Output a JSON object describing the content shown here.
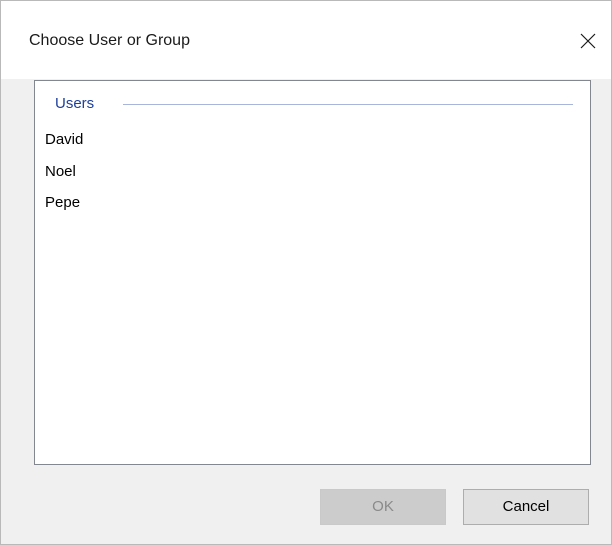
{
  "dialog": {
    "title": "Choose User or Group",
    "close_icon": "close-icon"
  },
  "list": {
    "group_label": "Users",
    "items": [
      {
        "label": "David"
      },
      {
        "label": "Noel"
      },
      {
        "label": "Pepe"
      }
    ]
  },
  "buttons": {
    "ok_label": "OK",
    "ok_enabled": false,
    "cancel_label": "Cancel"
  },
  "colors": {
    "group_label": "#1e3f9b",
    "group_line": "#a8b6dc",
    "disabled_button": "#cccccc"
  }
}
